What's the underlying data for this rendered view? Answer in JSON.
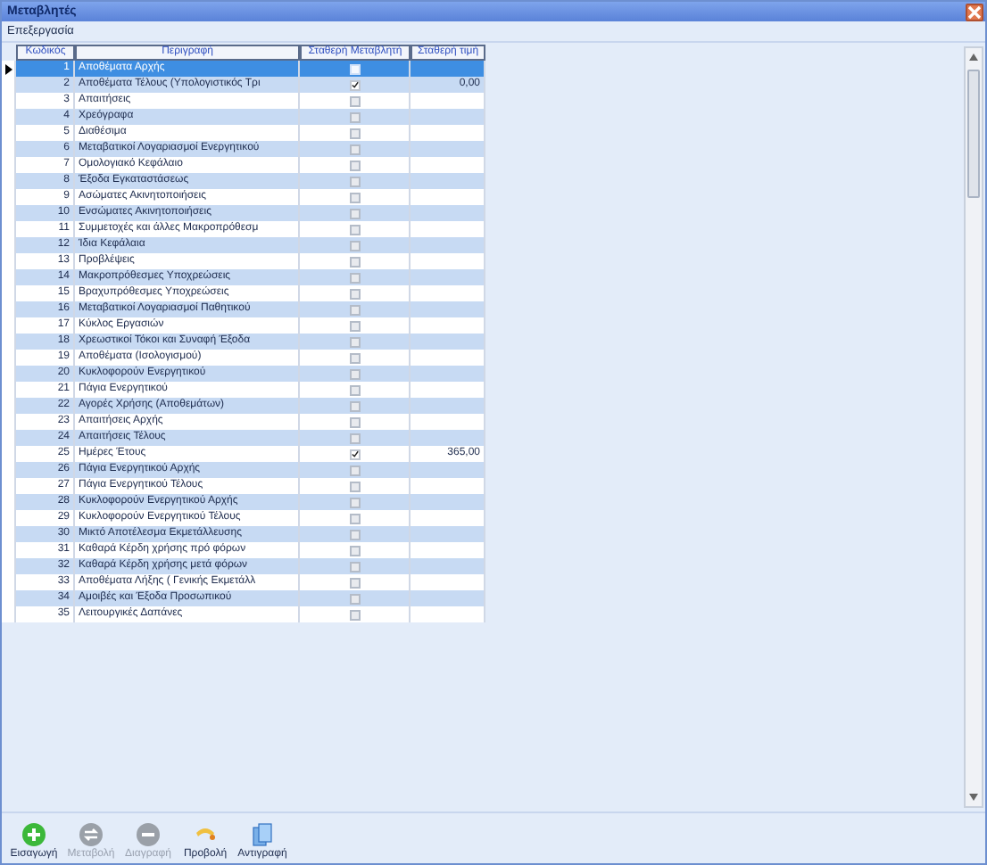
{
  "window": {
    "title": "Μεταβλητές"
  },
  "menu": [
    "Επεξεργασία"
  ],
  "table": {
    "columns": [
      "Κωδικός",
      "Περιγραφή",
      "Σταθερή Μεταβλητή",
      "Σταθερή τιμή"
    ],
    "rows": [
      {
        "code": "1",
        "description": "Αποθέματα Αρχής",
        "fixed": false,
        "value": "",
        "selected": true
      },
      {
        "code": "2",
        "description": "Αποθέματα Τέλους (Υπολογιστικός Τρι",
        "fixed": true,
        "value": "0,00",
        "selected": false
      },
      {
        "code": "3",
        "description": "Απαιτήσεις",
        "fixed": false,
        "value": "",
        "selected": false
      },
      {
        "code": "4",
        "description": "Χρεόγραφα",
        "fixed": false,
        "value": "",
        "selected": false
      },
      {
        "code": "5",
        "description": "Διαθέσιμα",
        "fixed": false,
        "value": "",
        "selected": false
      },
      {
        "code": "6",
        "description": "Μεταβατικοί Λογαριασμοί Ενεργητικού",
        "fixed": false,
        "value": "",
        "selected": false
      },
      {
        "code": "7",
        "description": "Ομολογιακό Κεφάλαιο",
        "fixed": false,
        "value": "",
        "selected": false
      },
      {
        "code": "8",
        "description": "Έξοδα Εγκαταστάσεως",
        "fixed": false,
        "value": "",
        "selected": false
      },
      {
        "code": "9",
        "description": "Ασώματες Ακινητοποιήσεις",
        "fixed": false,
        "value": "",
        "selected": false
      },
      {
        "code": "10",
        "description": "Ενσώματες Ακινητοποιήσεις",
        "fixed": false,
        "value": "",
        "selected": false
      },
      {
        "code": "11",
        "description": "Συμμετοχές και άλλες Μακροπρόθεσμ",
        "fixed": false,
        "value": "",
        "selected": false
      },
      {
        "code": "12",
        "description": "Ίδια Κεφάλαια",
        "fixed": false,
        "value": "",
        "selected": false
      },
      {
        "code": "13",
        "description": "Προβλέψεις",
        "fixed": false,
        "value": "",
        "selected": false
      },
      {
        "code": "14",
        "description": "Μακροπρόθεσμες Υποχρεώσεις",
        "fixed": false,
        "value": "",
        "selected": false
      },
      {
        "code": "15",
        "description": "Βραχυπρόθεσμες Υποχρεώσεις",
        "fixed": false,
        "value": "",
        "selected": false
      },
      {
        "code": "16",
        "description": "Μεταβατικοί Λογαριασμοί Παθητικού",
        "fixed": false,
        "value": "",
        "selected": false
      },
      {
        "code": "17",
        "description": "Κύκλος Εργασιών",
        "fixed": false,
        "value": "",
        "selected": false
      },
      {
        "code": "18",
        "description": "Χρεωστικοί Τόκοι και Συναφή Έξοδα",
        "fixed": false,
        "value": "",
        "selected": false
      },
      {
        "code": "19",
        "description": "Αποθέματα (Ισολογισμού)",
        "fixed": false,
        "value": "",
        "selected": false
      },
      {
        "code": "20",
        "description": "Κυκλοφορούν Ενεργητικού",
        "fixed": false,
        "value": "",
        "selected": false
      },
      {
        "code": "21",
        "description": "Πάγια Ενεργητικού",
        "fixed": false,
        "value": "",
        "selected": false
      },
      {
        "code": "22",
        "description": "Αγορές Χρήσης (Αποθεμάτων)",
        "fixed": false,
        "value": "",
        "selected": false
      },
      {
        "code": "23",
        "description": "Απαιτήσεις Αρχής",
        "fixed": false,
        "value": "",
        "selected": false
      },
      {
        "code": "24",
        "description": "Απαιτήσεις Τέλους",
        "fixed": false,
        "value": "",
        "selected": false
      },
      {
        "code": "25",
        "description": "Ημέρες Έτους",
        "fixed": true,
        "value": "365,00",
        "selected": false
      },
      {
        "code": "26",
        "description": "Πάγια Ενεργητικού Αρχής",
        "fixed": false,
        "value": "",
        "selected": false
      },
      {
        "code": "27",
        "description": "Πάγια Ενεργητικού Τέλους",
        "fixed": false,
        "value": "",
        "selected": false
      },
      {
        "code": "28",
        "description": "Κυκλοφορούν Ενεργητικού Αρχής",
        "fixed": false,
        "value": "",
        "selected": false
      },
      {
        "code": "29",
        "description": "Κυκλοφορούν Ενεργητικού Τέλους",
        "fixed": false,
        "value": "",
        "selected": false
      },
      {
        "code": "30",
        "description": "Μικτό Αποτέλεσμα Εκμετάλλευσης",
        "fixed": false,
        "value": "",
        "selected": false
      },
      {
        "code": "31",
        "description": "Καθαρά Κέρδη χρήσης πρό φόρων",
        "fixed": false,
        "value": "",
        "selected": false
      },
      {
        "code": "32",
        "description": "Καθαρά Κέρδη χρήσης μετά φόρων",
        "fixed": false,
        "value": "",
        "selected": false
      },
      {
        "code": "33",
        "description": "Αποθέματα Λήξης ( Γενικής Εκμετάλλ",
        "fixed": false,
        "value": "",
        "selected": false
      },
      {
        "code": "34",
        "description": "Αμοιβές και Έξοδα Προσωπικού",
        "fixed": false,
        "value": "",
        "selected": false
      },
      {
        "code": "35",
        "description": "Λειτουργικές Δαπάνες",
        "fixed": false,
        "value": "",
        "selected": false
      }
    ]
  },
  "toolbar": [
    {
      "kind": "add",
      "label": "Εισαγωγή",
      "disabled": false
    },
    {
      "kind": "edit",
      "label": "Μεταβολή",
      "disabled": true
    },
    {
      "kind": "delete",
      "label": "Διαγραφή",
      "disabled": true
    },
    {
      "kind": "view",
      "label": "Προβολή",
      "disabled": false
    },
    {
      "kind": "copy",
      "label": "Αντιγραφή",
      "disabled": false
    }
  ]
}
